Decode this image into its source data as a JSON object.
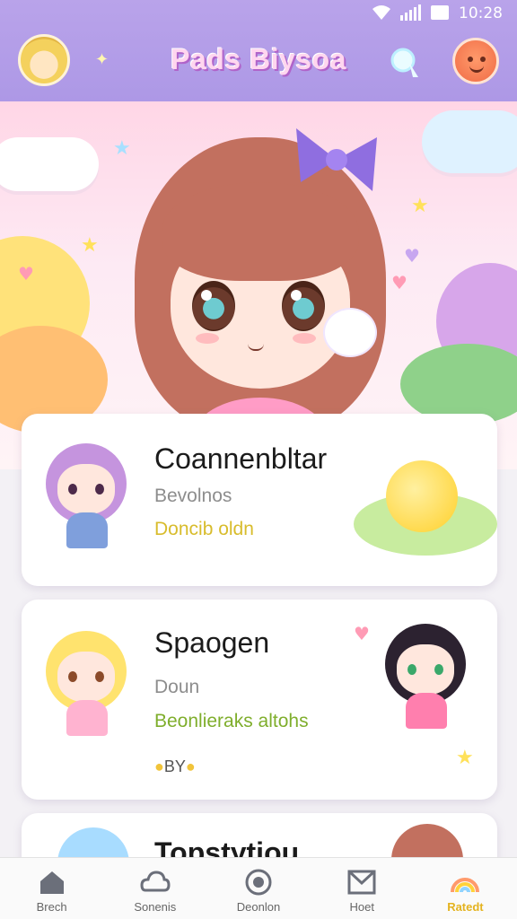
{
  "status_bar": {
    "time": "10:28"
  },
  "header": {
    "title": "Pads Biysoa"
  },
  "cards": [
    {
      "title": "Coannenbltar",
      "line1": "Bevolnos",
      "line2": "Doncib oldn"
    },
    {
      "title": "Spaogen",
      "line1": "Doun",
      "line2": "Beonlieraks altohs",
      "badge": "BY"
    },
    {
      "title": "Topstytiou"
    }
  ],
  "bottom_nav": {
    "items": [
      {
        "label": "Brech",
        "icon": "home-icon"
      },
      {
        "label": "Sonenis",
        "icon": "cloud-icon"
      },
      {
        "label": "Deonlon",
        "icon": "disc-icon"
      },
      {
        "label": "Hoet",
        "icon": "inbox-icon"
      },
      {
        "label": "Ratedt",
        "icon": "rainbow-icon",
        "active": true
      }
    ]
  },
  "colors": {
    "header": "#b9a3ea",
    "accent": "#e4b320",
    "pink": "#ff9cc6"
  }
}
